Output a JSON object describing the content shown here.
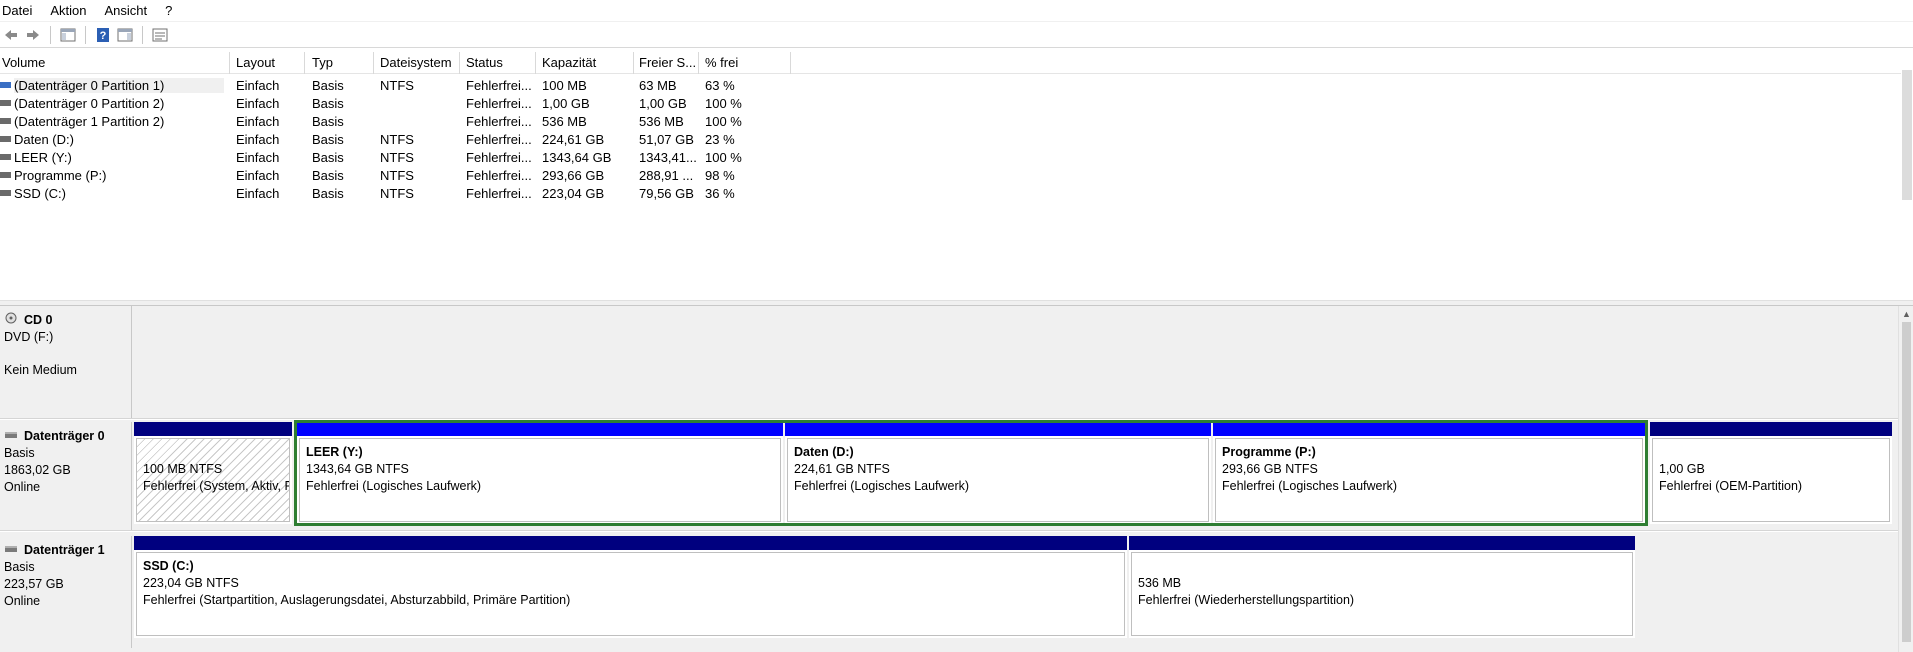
{
  "menu": [
    "Datei",
    "Aktion",
    "Ansicht",
    "?"
  ],
  "toolbar": [
    {
      "name": "back-icon"
    },
    {
      "name": "forward-icon"
    },
    {
      "name": "console-tree-icon"
    },
    {
      "name": "help-icon"
    },
    {
      "name": "action-pane-icon"
    },
    {
      "name": "properties-icon"
    }
  ],
  "volume_table": {
    "columns": [
      "Volume",
      "Layout",
      "Typ",
      "Dateisystem",
      "Status",
      "Kapazität",
      "Freier S...",
      "% frei"
    ],
    "rows": [
      [
        "(Datenträger 0 Partition 1)",
        "Einfach",
        "Basis",
        "NTFS",
        "Fehlerfrei...",
        "100 MB",
        "63 MB",
        "63 %"
      ],
      [
        "(Datenträger 0 Partition 2)",
        "Einfach",
        "Basis",
        "",
        "Fehlerfrei...",
        "1,00 GB",
        "1,00 GB",
        "100 %"
      ],
      [
        "(Datenträger 1 Partition 2)",
        "Einfach",
        "Basis",
        "",
        "Fehlerfrei...",
        "536 MB",
        "536 MB",
        "100 %"
      ],
      [
        "Daten (D:)",
        "Einfach",
        "Basis",
        "NTFS",
        "Fehlerfrei...",
        "224,61 GB",
        "51,07 GB",
        "23 %"
      ],
      [
        "LEER (Y:)",
        "Einfach",
        "Basis",
        "NTFS",
        "Fehlerfrei...",
        "1343,64 GB",
        "1343,41...",
        "100 %"
      ],
      [
        "Programme (P:)",
        "Einfach",
        "Basis",
        "NTFS",
        "Fehlerfrei...",
        "293,66 GB",
        "288,91 ...",
        "98 %"
      ],
      [
        "SSD (C:)",
        "Einfach",
        "Basis",
        "NTFS",
        "Fehlerfrei...",
        "223,04 GB",
        "79,56 GB",
        "36 %"
      ]
    ]
  },
  "disks": {
    "cd0": {
      "name": "CD 0",
      "line1": "DVD (F:)",
      "line2": "Kein Medium"
    },
    "disk0": {
      "name": "Datenträger 0",
      "type": "Basis",
      "size": "1863,02 GB",
      "status": "Online"
    },
    "disk1": {
      "name": "Datenträger 1",
      "type": "Basis",
      "size": "223,57 GB",
      "status": "Online"
    }
  },
  "partitions": {
    "d0p1": {
      "name": "",
      "size": "100 MB NTFS",
      "status": "Fehlerfrei (System, Aktiv, Primäre Partition)"
    },
    "leer": {
      "name": "LEER  (Y:)",
      "size": "1343,64 GB NTFS",
      "status": "Fehlerfrei (Logisches Laufwerk)"
    },
    "daten": {
      "name": "Daten  (D:)",
      "size": "224,61 GB NTFS",
      "status": "Fehlerfrei (Logisches Laufwerk)"
    },
    "programme": {
      "name": "Programme  (P:)",
      "size": "293,66 GB NTFS",
      "status": "Fehlerfrei (Logisches Laufwerk)"
    },
    "oem": {
      "name": "",
      "size": "1,00 GB",
      "status": "Fehlerfrei (OEM-Partition)"
    },
    "ssd": {
      "name": "SSD  (C:)",
      "size": "223,04 GB NTFS",
      "status": "Fehlerfrei (Startpartition, Auslagerungsdatei, Absturzabbild, Primäre Partition)"
    },
    "recovery": {
      "name": "",
      "size": "536 MB",
      "status": "Fehlerfrei (Wiederherstellungspartition)"
    }
  },
  "colors": {
    "primary_bar": "#00007f",
    "logical_bar": "#0000ff",
    "extended_border": "#2e7d32"
  }
}
